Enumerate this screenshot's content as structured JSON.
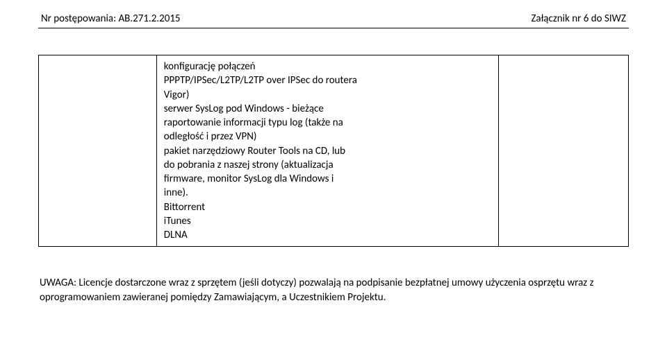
{
  "header": {
    "left": "Nr postępowania: AB.271.2.2015",
    "right": "Załącznik nr 6 do SIWZ"
  },
  "table": {
    "col1": "",
    "col2_lines": [
      "konfigurację połączeń",
      "PPPTP/IPSec/L2TP/L2TP over IPSec do routera",
      "Vigor)",
      "serwer SysLog pod Windows - bieżące",
      "raportowanie informacji typu log (także na",
      "odległość i przez VPN)",
      "pakiet narzędziowy Router Tools na CD, lub",
      "do pobrania z naszej strony (aktualizacja",
      "firmware, monitor SysLog dla Windows i",
      "inne).",
      "Bittorrent",
      "iTunes",
      "DLNA"
    ],
    "col3": ""
  },
  "note": {
    "label": "UWAGA:",
    "text": " Licencje dostarczone wraz z sprzętem (jeśli dotyczy) pozwalają na podpisanie bezpłatnej umowy użyczenia osprzętu wraz z oprogramowaniem zawieranej pomiędzy Zamawiającym, a Uczestnikiem Projektu."
  }
}
